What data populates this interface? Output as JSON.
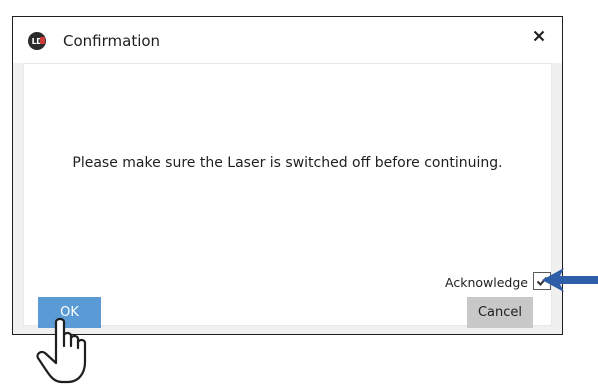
{
  "dialog": {
    "title": "Confirmation",
    "app_logo_text": "LD",
    "message": "Please make sure the Laser is switched off before continuing.",
    "acknowledge_label": "Acknowledge",
    "acknowledge_checked": true,
    "ok_label": "OK",
    "cancel_label": "Cancel"
  },
  "icons": {
    "close": "close-icon",
    "check": "checkmark-icon",
    "arrow": "arrow-left-icon",
    "hand": "hand-pointer-icon"
  },
  "colors": {
    "ok_button": "#5b9bd5",
    "cancel_button": "#c8c8c8",
    "arrow": "#2e5ea8",
    "logo_accent": "#d23a3a"
  }
}
